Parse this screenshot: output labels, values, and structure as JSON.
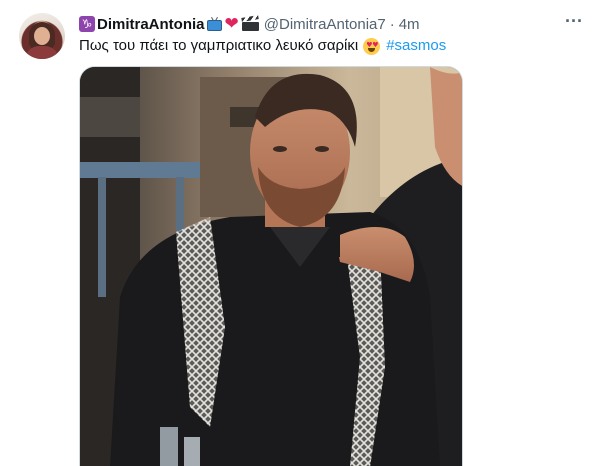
{
  "tweet": {
    "display_name": "DimitraAntonia",
    "zodiac_glyph": "♑",
    "handle": "@DimitraAntonia7",
    "separator": "·",
    "time": "4m",
    "heart_glyph": "❤",
    "more_glyph": "···",
    "text": "Πως του πάει το γαμπριατικο λευκό σαρίκι",
    "hashtag": "#sasmos",
    "emoji_heart_glyph": "♥"
  },
  "colors": {
    "link": "#1d9bf0",
    "secondary_text": "#536471",
    "heart": "#e0245e",
    "zodiac_badge": "#8e44ad"
  },
  "icons": {
    "zodiac": "capricorn-icon",
    "tv": "television-icon",
    "heart": "red-heart-icon",
    "clapper": "clapper-board-icon",
    "more": "more-options-icon",
    "emoji": "heart-eyes-emoji-icon"
  }
}
